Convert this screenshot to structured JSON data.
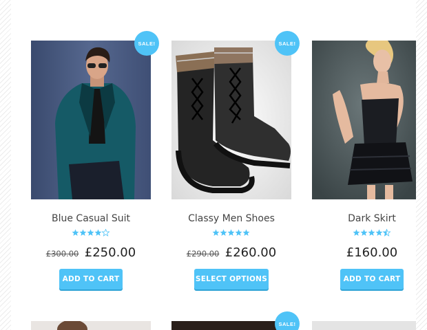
{
  "products": [
    {
      "name": "Blue Casual Suit",
      "sale_badge": "SALE!",
      "rating": 4,
      "old_price": "£300.00",
      "price": "£250.00",
      "button": "ADD TO CART"
    },
    {
      "name": "Classy Men Shoes",
      "sale_badge": "SALE!",
      "rating": 5,
      "old_price": "£290.00",
      "price": "£260.00",
      "button": "SELECT OPTIONS"
    },
    {
      "name": "Dark Skirt",
      "rating": 4.5,
      "price": "£160.00",
      "button": "ADD TO CART"
    }
  ],
  "row2": {
    "sale_badge": "SALE!"
  },
  "colors": {
    "accent": "#4fc3f7",
    "star": "#4fc3f7"
  }
}
